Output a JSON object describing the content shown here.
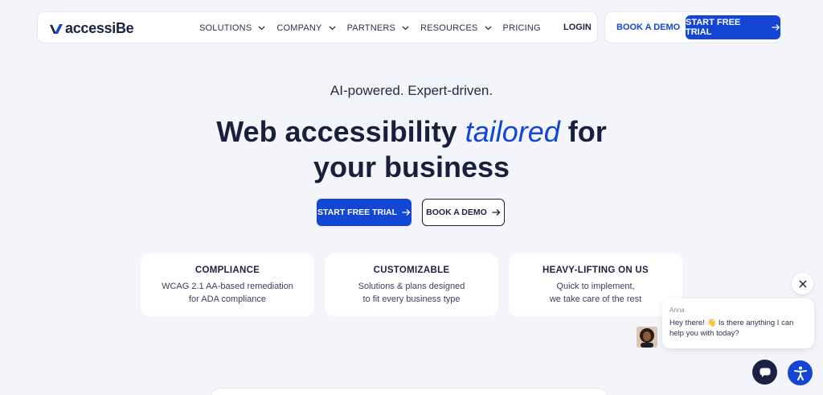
{
  "brand": {
    "logo_text": "accessiBe"
  },
  "nav": {
    "items": [
      {
        "label": "SOLUTIONS",
        "has_dropdown": true
      },
      {
        "label": "COMPANY",
        "has_dropdown": true
      },
      {
        "label": "PARTNERS",
        "has_dropdown": true
      },
      {
        "label": "RESOURCES",
        "has_dropdown": true
      },
      {
        "label": "PRICING",
        "has_dropdown": false
      }
    ],
    "login": "LOGIN",
    "book_demo": "BOOK A DEMO",
    "start_trial": "START FREE TRIAL"
  },
  "hero": {
    "eyebrow": "AI-powered. Expert-driven.",
    "headline_start": "Web accessibility ",
    "headline_accent": "tailored",
    "headline_end": " for",
    "headline_line2": "your business",
    "primary_cta": "START FREE TRIAL",
    "secondary_cta": "BOOK A DEMO"
  },
  "features": [
    {
      "title": "COMPLIANCE",
      "line1": "WCAG 2.1 AA-based remediation",
      "line2": "for ADA compliance"
    },
    {
      "title": "CUSTOMIZABLE",
      "line1": "Solutions & plans designed",
      "line2": "to fit every business type"
    },
    {
      "title": "HEAVY-LIFTING ON US",
      "line1": "Quick to implement,",
      "line2": "we take care of the rest"
    }
  ],
  "chat": {
    "agent_name": "Anna",
    "message": "Hey there! 👋 Is there anything I can help you with today?"
  },
  "icons": {
    "close": "close-icon",
    "chat": "chat-bubble-icon",
    "accessibility": "accessibility-person-icon",
    "arrow": "arrow-right-icon",
    "chevron": "chevron-down-icon"
  },
  "colors": {
    "accent": "#1446d6",
    "navy": "#1b2142",
    "background": "#f3f5fa"
  }
}
